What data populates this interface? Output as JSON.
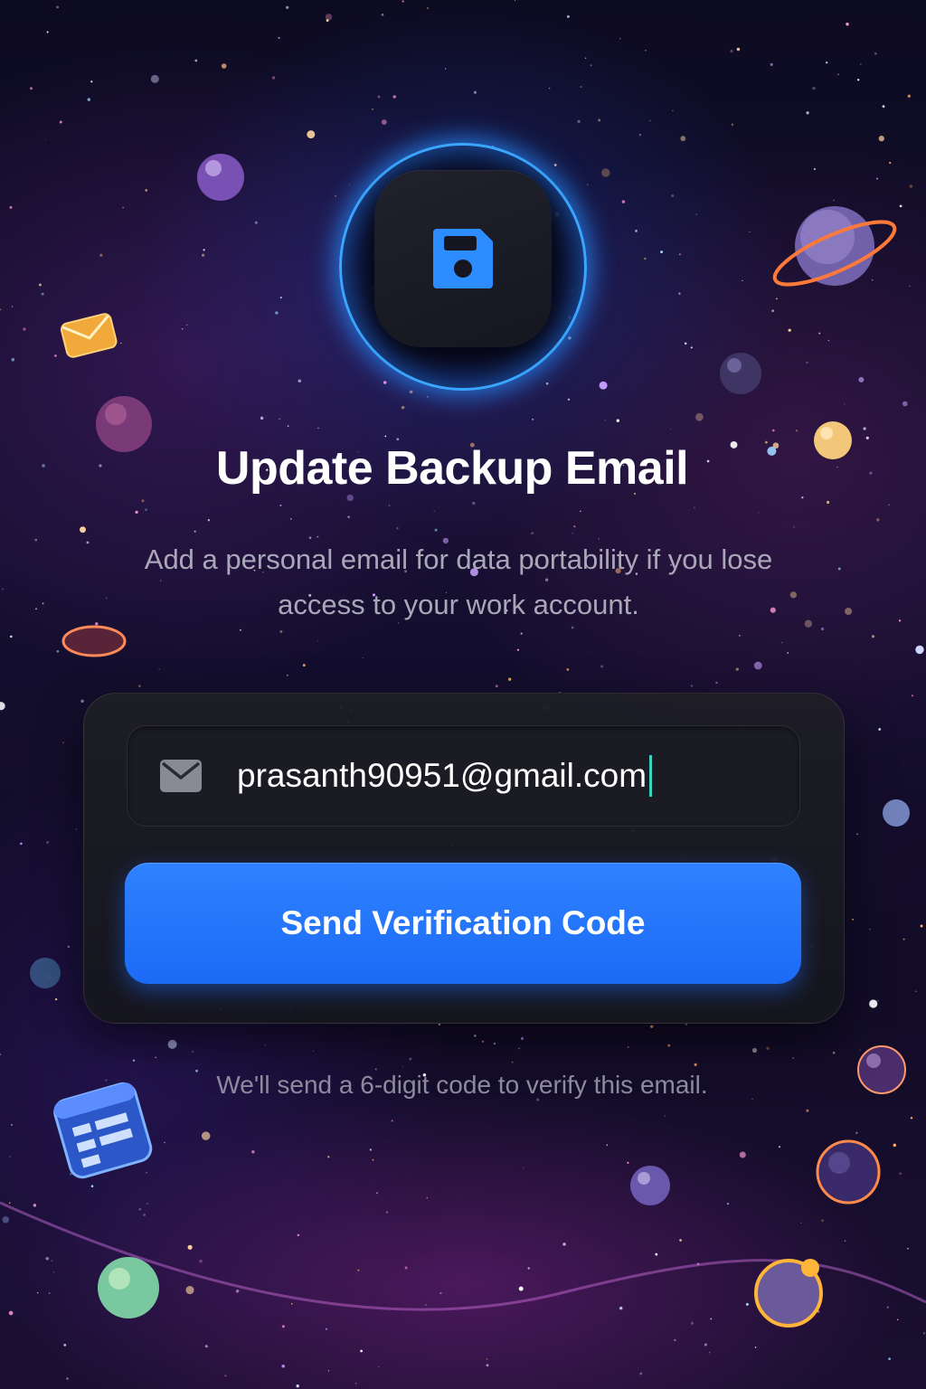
{
  "header": {
    "icon": "floppy-disk-icon",
    "title": "Update Backup Email",
    "subtitle": "Add a personal email for data portability if you lose access to your work account."
  },
  "form": {
    "email_icon": "envelope-icon",
    "email_value": "prasanth90951@gmail.com",
    "submit_label": "Send Verification Code"
  },
  "footer": {
    "hint": "We'll send a 6-digit code to verify this email."
  },
  "colors": {
    "accent": "#2f82ff",
    "ring_glow": "#3aa6ff",
    "caret": "#3fd0c4",
    "background": "#0d0b22"
  },
  "decorations": [
    "planet-icon",
    "ringed-planet-icon",
    "envelope-sticker-icon",
    "calendar-sticker-icon",
    "bubble-icon"
  ]
}
